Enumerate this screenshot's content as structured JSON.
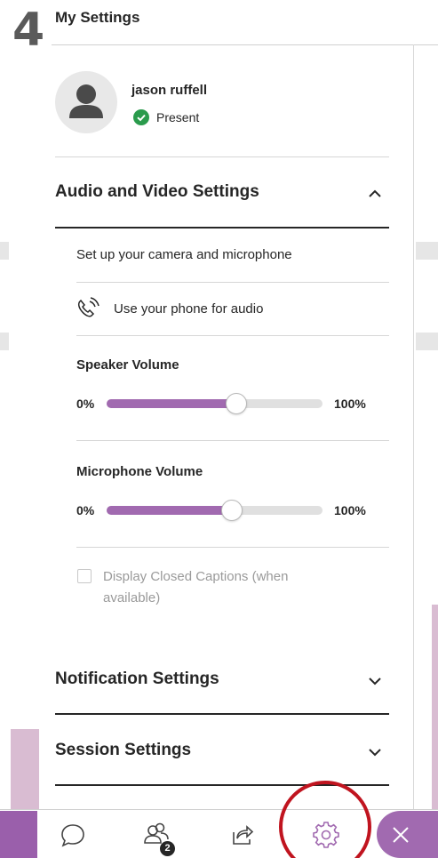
{
  "step_number": "4",
  "header": {
    "title": "My Settings"
  },
  "user": {
    "name": "jason ruffell",
    "status": "Present"
  },
  "audio_video": {
    "title": "Audio and Video Settings",
    "setup_link": "Set up your camera and microphone",
    "phone_audio": "Use your phone for audio",
    "speaker": {
      "label": "Speaker Volume",
      "min_label": "0%",
      "max_label": "100%",
      "level": 0.6
    },
    "microphone": {
      "label": "Microphone Volume",
      "min_label": "0%",
      "max_label": "100%",
      "level": 0.58
    },
    "closed_captions": "Display Closed Captions (when available)"
  },
  "notification_settings": {
    "title": "Notification Settings"
  },
  "session_settings": {
    "title": "Session Settings"
  },
  "bottom_bar": {
    "participants_badge": "2"
  },
  "colors": {
    "accent": "#a16ab0",
    "present_green": "#2a9b4c",
    "highlight_red": "#c0141f"
  },
  "icons": [
    "user-avatar-icon",
    "check-circle-icon",
    "chevron-up-icon",
    "phone-audio-icon",
    "chevron-down-icon",
    "chat-icon",
    "participants-icon",
    "share-content-icon",
    "settings-gear-icon",
    "close-icon"
  ]
}
